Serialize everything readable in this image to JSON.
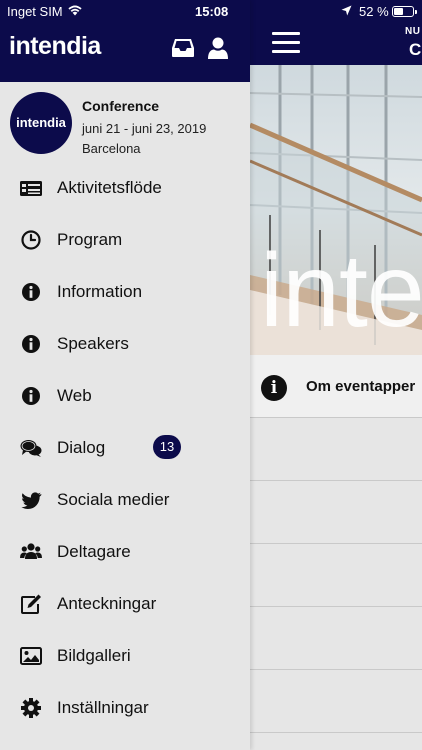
{
  "status_bar": {
    "carrier": "Inget SIM",
    "time": "15:08",
    "battery_text": "52 %",
    "battery_level": 0.52
  },
  "drawer": {
    "brand": "intendia",
    "event": {
      "logo_text": "intendia",
      "title": "Conference",
      "dates": "juni 21 - juni 23, 2019",
      "location": "Barcelona"
    },
    "menu": [
      {
        "label": "Aktivitetsflöde",
        "icon": "news-feed-icon"
      },
      {
        "label": "Program",
        "icon": "clock-icon"
      },
      {
        "label": "Information",
        "icon": "info-icon"
      },
      {
        "label": "Speakers",
        "icon": "info-icon"
      },
      {
        "label": "Web",
        "icon": "info-icon"
      },
      {
        "label": "Dialog",
        "icon": "chat-bubbles-icon",
        "badge": "13"
      },
      {
        "label": "Sociala medier",
        "icon": "twitter-bird-icon"
      },
      {
        "label": "Deltagare",
        "icon": "users-icon"
      },
      {
        "label": "Anteckningar",
        "icon": "edit-note-icon"
      },
      {
        "label": "Bildgalleri",
        "icon": "image-gallery-icon"
      },
      {
        "label": "Inställningar",
        "icon": "gear-icon"
      }
    ]
  },
  "main": {
    "header_sub": "NU",
    "header_title": "C",
    "hero_text": "inte",
    "list": [
      {
        "label": "Om eventapper",
        "icon": "info-icon"
      },
      {
        "label": ""
      },
      {
        "label": ""
      },
      {
        "label": ""
      },
      {
        "label": ""
      },
      {
        "label": ""
      }
    ]
  },
  "colors": {
    "brand_navy": "#0c0b4b",
    "drawer_bg": "#e6e6e6",
    "text": "#111111"
  }
}
